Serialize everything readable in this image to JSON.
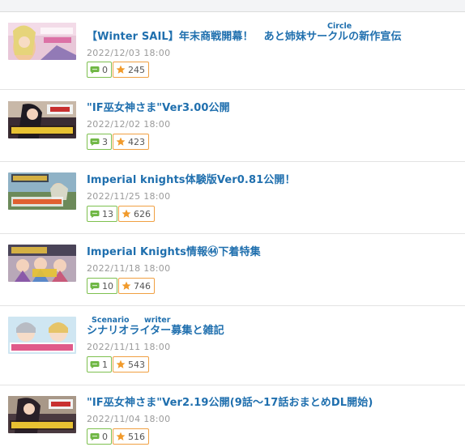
{
  "colors": {
    "title": "#1f6fae",
    "date": "#9a9a9a",
    "comment_border": "#7ec04f",
    "star_border": "#f0a042"
  },
  "icons": {
    "comment": "speech-bubble-icon",
    "star": "star-icon"
  },
  "posts": [
    {
      "title": "【Winter SAIL】年末商戦開幕！　あと姉妹サークルの新作宣伝",
      "ruby": [
        {
          "text": "Circle"
        }
      ],
      "date": "2022/12/03 18:00",
      "comments": "0",
      "stars": "245"
    },
    {
      "title": "\"IF巫女神さま\"Ver3.00公開",
      "ruby": [],
      "date": "2022/12/02 18:00",
      "comments": "3",
      "stars": "423"
    },
    {
      "title": "Imperial knights体験版Ver0.81公開！",
      "ruby": [],
      "date": "2022/11/25 18:00",
      "comments": "13",
      "stars": "626"
    },
    {
      "title": "Imperial Knights情報㊹下着特集",
      "ruby": [],
      "date": "2022/11/18 18:00",
      "comments": "10",
      "stars": "746"
    },
    {
      "title": "シナリオライター募集と雑記",
      "ruby": [
        {
          "text": "Scenario"
        },
        {
          "text": "writer"
        }
      ],
      "date": "2022/11/11 18:00",
      "comments": "1",
      "stars": "543"
    },
    {
      "title": "\"IF巫女神さま\"Ver2.19公開(9話～17話おまとめDL開始)",
      "ruby": [],
      "date": "2022/11/04 18:00",
      "comments": "0",
      "stars": "516"
    }
  ]
}
